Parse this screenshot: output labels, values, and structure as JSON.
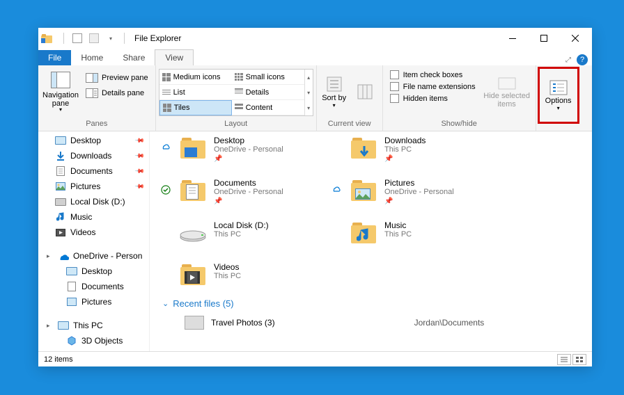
{
  "window": {
    "title": "File Explorer"
  },
  "tabs": {
    "file": "File",
    "home": "Home",
    "share": "Share",
    "view": "View"
  },
  "ribbon": {
    "panes": {
      "label": "Panes",
      "navigation": "Navigation pane",
      "preview": "Preview pane",
      "details": "Details pane"
    },
    "layout": {
      "label": "Layout",
      "medium": "Medium icons",
      "small": "Small icons",
      "list": "List",
      "details": "Details",
      "tiles": "Tiles",
      "content": "Content"
    },
    "currentview": {
      "label": "Current view",
      "sort": "Sort by"
    },
    "showhide": {
      "label": "Show/hide",
      "item_check": "Item check boxes",
      "file_ext": "File name extensions",
      "hidden": "Hidden items",
      "hide_selected": "Hide selected items"
    },
    "options": "Options"
  },
  "nav": {
    "desktop": "Desktop",
    "downloads": "Downloads",
    "documents": "Documents",
    "pictures": "Pictures",
    "localdisk": "Local Disk (D:)",
    "music": "Music",
    "videos": "Videos",
    "onedrive": "OneDrive - Person",
    "od_desktop": "Desktop",
    "od_documents": "Documents",
    "od_pictures": "Pictures",
    "thispc": "This PC",
    "objects3d": "3D Objects"
  },
  "tiles": {
    "desktop": {
      "name": "Desktop",
      "sub": "OneDrive - Personal"
    },
    "downloads": {
      "name": "Downloads",
      "sub": "This PC"
    },
    "documents": {
      "name": "Documents",
      "sub": "OneDrive - Personal"
    },
    "pictures": {
      "name": "Pictures",
      "sub": "OneDrive - Personal"
    },
    "localdisk": {
      "name": "Local Disk (D:)",
      "sub": "This PC"
    },
    "music": {
      "name": "Music",
      "sub": "This PC"
    },
    "videos": {
      "name": "Videos",
      "sub": "This PC"
    }
  },
  "recent": {
    "header": "Recent files (5)",
    "item1": {
      "name": "Travel Photos (3)",
      "path": "Jordan\\Documents"
    }
  },
  "status": {
    "count": "12 items"
  }
}
